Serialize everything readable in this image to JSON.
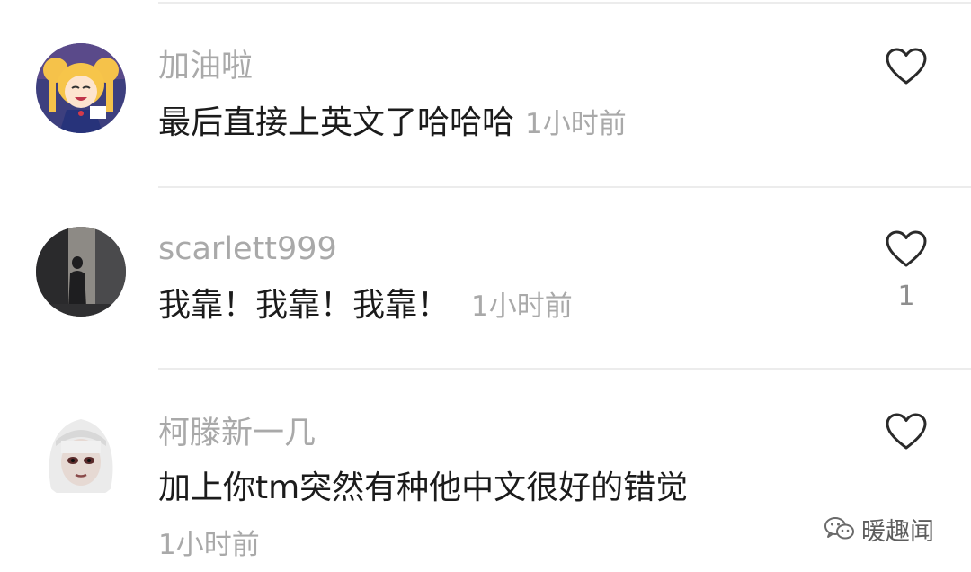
{
  "comments": [
    {
      "username": "加油啦",
      "text": "最后直接上英文了哈哈哈",
      "time": "1小时前",
      "avatar_icon": "sailor-moon-avatar-icon"
    },
    {
      "username": "scarlett999",
      "text": "我靠！我靠！我靠！",
      "time": "1小时前",
      "like_count": "1",
      "avatar_icon": "silhouette-doorway-avatar-icon"
    },
    {
      "username": "柯滕新一几",
      "text": "加上你tm突然有种他中文很好的错觉",
      "time": "1小时前",
      "avatar_icon": "memoji-avatar-icon"
    }
  ],
  "watermark": {
    "label": "暖趣闻",
    "icon": "wechat-icon"
  },
  "colors": {
    "text": "#1b1b1b",
    "muted": "#a9a9a9",
    "divider": "#ececec"
  }
}
